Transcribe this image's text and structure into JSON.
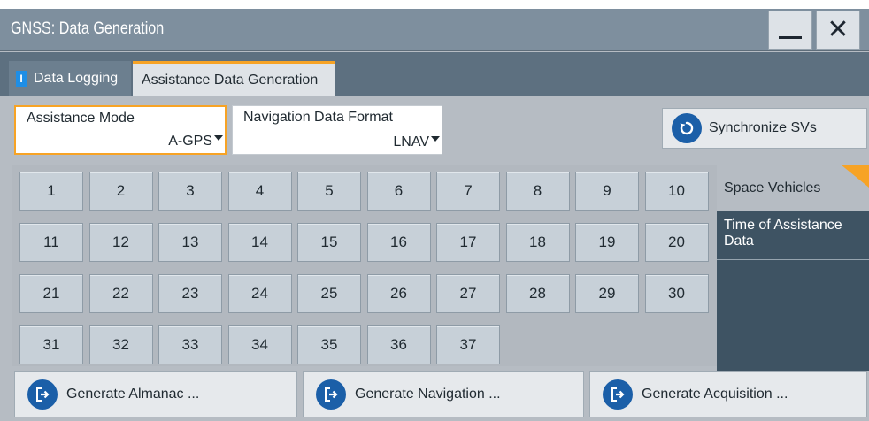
{
  "window": {
    "title": "GNSS: Data Generation"
  },
  "tabs": [
    {
      "label": "Data Logging",
      "active": false,
      "indicator": "info-indicator"
    },
    {
      "label": "Assistance Data Generation",
      "active": true
    }
  ],
  "params": {
    "assistance_mode": {
      "label": "Assistance Mode",
      "value": "A-GPS"
    },
    "nav_data_format": {
      "label": "Navigation Data Format",
      "value": "LNAV"
    }
  },
  "sync_button": {
    "label": "Synchronize SVs",
    "icon": "refresh-icon"
  },
  "space_vehicles": [
    "1",
    "2",
    "3",
    "4",
    "5",
    "6",
    "7",
    "8",
    "9",
    "10",
    "11",
    "12",
    "13",
    "14",
    "15",
    "16",
    "17",
    "18",
    "19",
    "20",
    "21",
    "22",
    "23",
    "24",
    "25",
    "26",
    "27",
    "28",
    "29",
    "30",
    "31",
    "32",
    "33",
    "34",
    "35",
    "36",
    "37"
  ],
  "side_menu": {
    "items": [
      {
        "label": "Space Vehicles",
        "active": true
      },
      {
        "label": "Time of Assistance Data",
        "active": false
      }
    ]
  },
  "generate_buttons": {
    "almanac": {
      "label": "Generate Almanac ..."
    },
    "navigation": {
      "label": "Generate Navigation ..."
    },
    "acquisition": {
      "label": "Generate Acquisition ..."
    }
  },
  "colors": {
    "accent": "#f7a325",
    "title_bar": "#7e8f9e",
    "side_panel": "#3e5363",
    "button_icon": "#1b5fa8"
  }
}
